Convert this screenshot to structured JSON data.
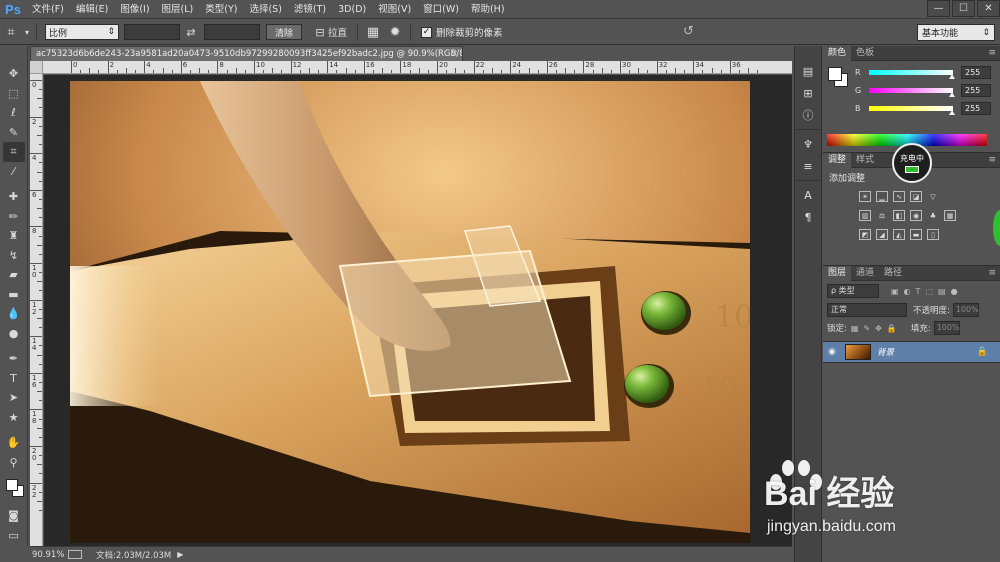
{
  "app": {
    "logo": "Ps",
    "menu": [
      "文件(F)",
      "编辑(E)",
      "图像(I)",
      "图层(L)",
      "类型(Y)",
      "选择(S)",
      "滤镜(T)",
      "3D(D)",
      "视图(V)",
      "窗口(W)",
      "帮助(H)"
    ],
    "window_controls": [
      "—",
      "☐",
      "✕"
    ]
  },
  "options": {
    "ratio_label": "比例",
    "clear_label": "清除",
    "straighten_label": "拉直",
    "delete_cropped_label": "删除裁剪的像素",
    "delete_cropped_checked": true,
    "workspace_label": "基本功能"
  },
  "document": {
    "tab_title": "ac75323d6b6de243-23a9581ad20a0473-9510db97299280093ff3425ef92badc2.jpg @ 90.9%(RGB/8#) *",
    "zoom": "90.91%",
    "doc_size": "文档:2.03M/2.03M"
  },
  "rulers": {
    "h_ticks": [
      "0",
      "2",
      "4",
      "6",
      "8",
      "10",
      "12",
      "14",
      "16",
      "18",
      "20",
      "22",
      "24",
      "26",
      "28",
      "30",
      "32",
      "34",
      "36"
    ],
    "v_ticks": [
      "0",
      "2",
      "4",
      "6",
      "8",
      "1\n0",
      "1\n2",
      "1\n4",
      "1\n6",
      "1\n8",
      "2\n0",
      "2\n2"
    ]
  },
  "photo": {
    "text_10": "10",
    "text_19": "19"
  },
  "panels": {
    "color_tabs": [
      "颜色",
      "色板"
    ],
    "sliders": [
      {
        "label": "R",
        "value": "255",
        "color": "#00ffff"
      },
      {
        "label": "G",
        "value": "255",
        "color": "#ff00ff"
      },
      {
        "label": "B",
        "value": "255",
        "color": "#ffff00"
      }
    ],
    "charging_label": "充电中",
    "adjust_tabs": [
      "调整",
      "样式"
    ],
    "adjust_title": "添加调整",
    "layers_tabs": [
      "图层",
      "通道",
      "路径"
    ],
    "filter_label": "ρ 类型",
    "blend_mode": "正常",
    "opacity_label": "不透明度:",
    "opacity_value": "100%",
    "lock_label": "锁定:",
    "fill_label": "填充:",
    "fill_value": "100%",
    "layer_name": "背景"
  },
  "watermark": {
    "brand": "Bai   经验",
    "url": "jingyan.baidu.com"
  },
  "colors": {
    "ui_bg": "#535353",
    "selected_layer": "#5e7fa8",
    "accent_blue": "#4ea7ff",
    "charge_green": "#2fbf2f"
  }
}
